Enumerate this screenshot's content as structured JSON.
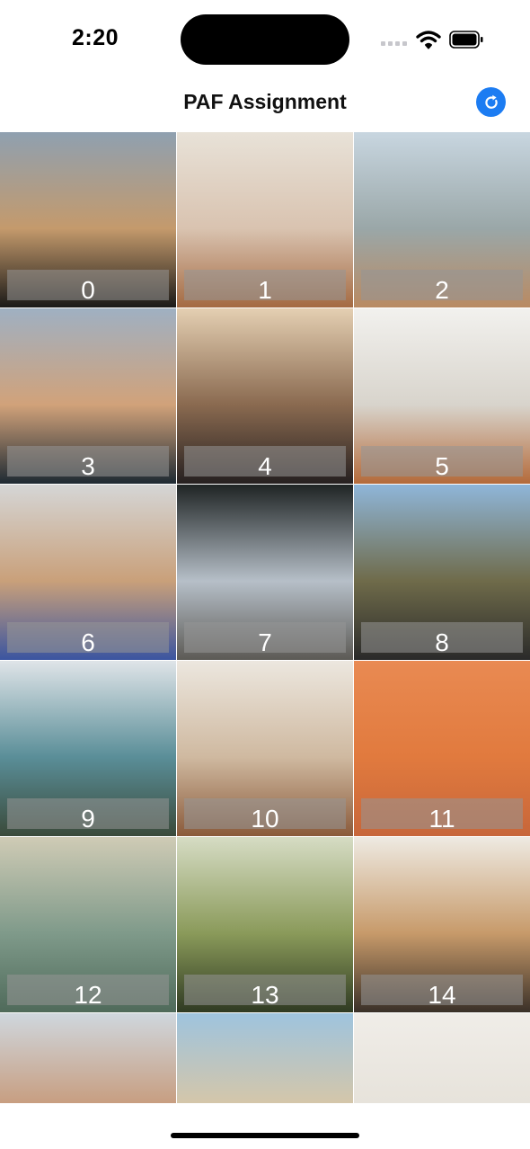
{
  "status_bar": {
    "time": "2:20"
  },
  "nav": {
    "title": "PAF Assignment",
    "refresh_icon": "refresh-icon",
    "accent_color": "#1c7cf2"
  },
  "grid": {
    "items": [
      {
        "label": "0",
        "colors": [
          "#8fa0b0",
          "#c49a6c",
          "#1b1a18"
        ]
      },
      {
        "label": "1",
        "colors": [
          "#e8e2d8",
          "#d9c3b0",
          "#a46a42"
        ]
      },
      {
        "label": "2",
        "colors": [
          "#c8d6e0",
          "#9aa7a8",
          "#b98a62"
        ]
      },
      {
        "label": "3",
        "colors": [
          "#9fb0c2",
          "#d1a27a",
          "#1e2a33"
        ]
      },
      {
        "label": "4",
        "colors": [
          "#e4cfb2",
          "#8a6a50",
          "#262020"
        ]
      },
      {
        "label": "5",
        "colors": [
          "#f2f1ee",
          "#d8d4cc",
          "#b46a3a"
        ]
      },
      {
        "label": "6",
        "colors": [
          "#d5d6d6",
          "#c9a07a",
          "#3b55a0"
        ]
      },
      {
        "label": "7",
        "colors": [
          "#1f2424",
          "#b6bfc8",
          "#5c5a55"
        ]
      },
      {
        "label": "8",
        "colors": [
          "#8fb6d9",
          "#6f6b4a",
          "#2a2a2a"
        ]
      },
      {
        "label": "9",
        "colors": [
          "#dfe4e8",
          "#5a8e98",
          "#3a4a3a"
        ]
      },
      {
        "label": "10",
        "colors": [
          "#ece7df",
          "#cfb9a0",
          "#8a5a3a"
        ]
      },
      {
        "label": "11",
        "colors": [
          "#e98a52",
          "#e17a3e",
          "#c7663a"
        ]
      },
      {
        "label": "12",
        "colors": [
          "#cfcbb5",
          "#7f9a8a",
          "#4f6a5a"
        ]
      },
      {
        "label": "13",
        "colors": [
          "#d6dcc4",
          "#8a9a5a",
          "#2f3a22"
        ]
      },
      {
        "label": "14",
        "colors": [
          "#eeeae2",
          "#c79a6a",
          "#3a3028"
        ]
      },
      {
        "label": "",
        "colors": [
          "#cfd7de",
          "#c79a7a",
          "#8a6a5a"
        ]
      },
      {
        "label": "",
        "colors": [
          "#9ec4de",
          "#d8c6a6",
          "#e6d2b2"
        ]
      },
      {
        "label": "",
        "colors": [
          "#f0ede8",
          "#e6e2da",
          "#d6d0c4"
        ]
      }
    ]
  },
  "home_indicator": true
}
